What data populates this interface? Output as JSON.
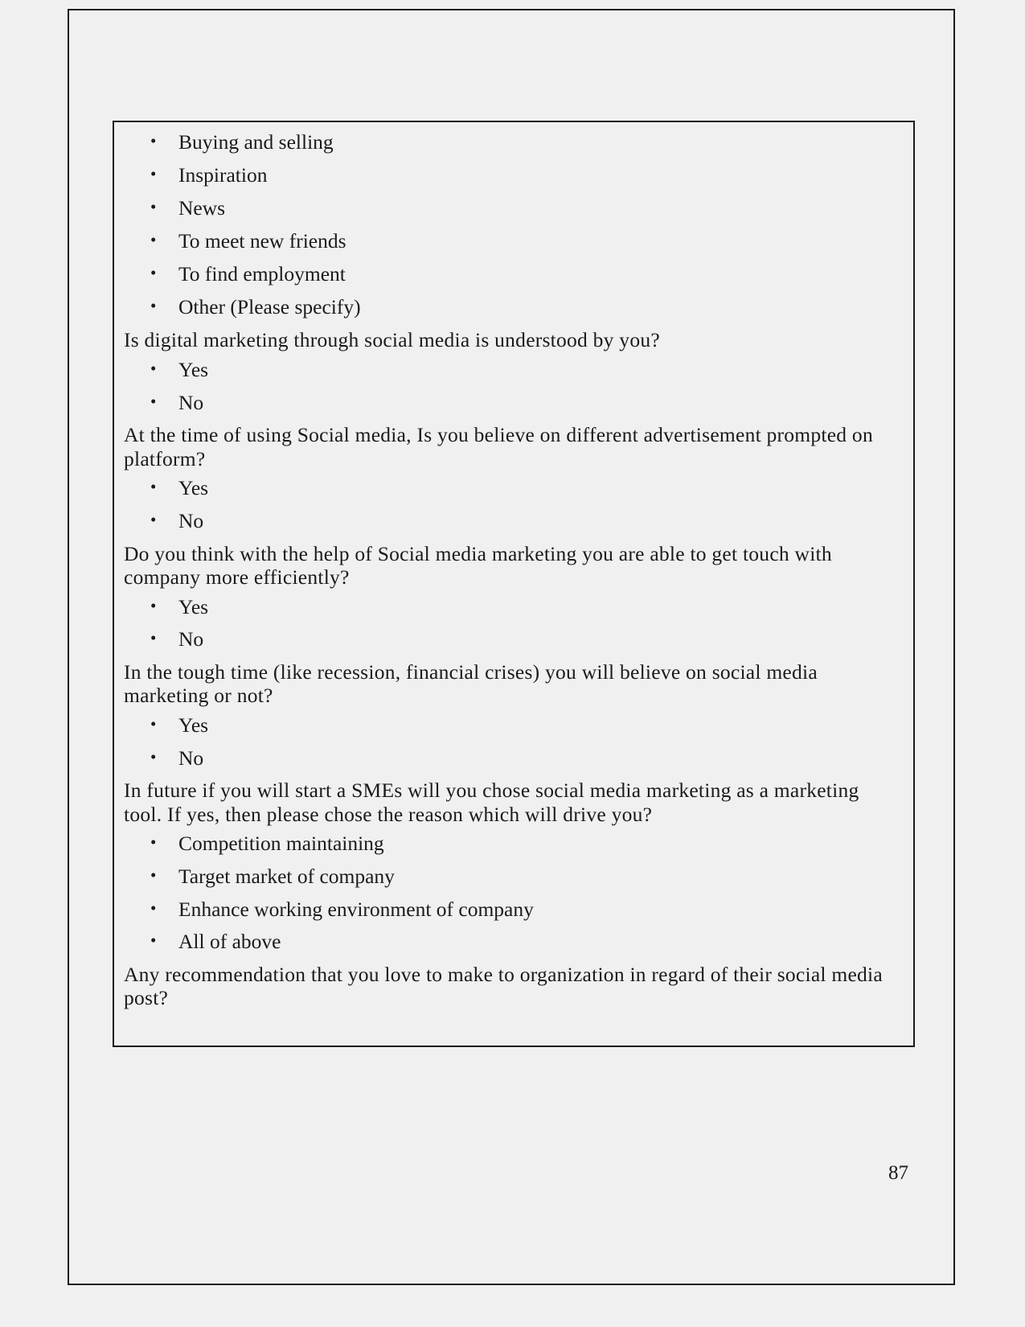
{
  "page": {
    "number": "87",
    "background_color": "#f0f0f0",
    "text_color": "#1a1a1a",
    "border_color": "#1a1a1a"
  },
  "bullet_glyph": "•",
  "blocks": [
    {
      "kind": "list",
      "name": "purpose-of-use-options",
      "items": [
        "Buying and selling",
        "Inspiration",
        "News",
        "To meet new friends",
        "To find employment",
        "Other (Please specify)"
      ]
    },
    {
      "kind": "question",
      "name": "question-digital-marketing-understood",
      "text": "Is digital marketing through social media is understood by you?"
    },
    {
      "kind": "list",
      "name": "answers-digital-marketing-understood",
      "items": [
        "Yes",
        "No"
      ]
    },
    {
      "kind": "question",
      "name": "question-believe-advertisement",
      "text": "At the time of using Social media, Is you believe on different advertisement prompted on platform?"
    },
    {
      "kind": "list",
      "name": "answers-believe-advertisement",
      "items": [
        "Yes",
        "No"
      ]
    },
    {
      "kind": "question",
      "name": "question-get-touch-with-company",
      "text": "Do you think with the help of Social media marketing you are able to get touch with company more efficiently?"
    },
    {
      "kind": "list",
      "name": "answers-get-touch-with-company",
      "items": [
        "Yes",
        "No"
      ]
    },
    {
      "kind": "question",
      "name": "question-tough-time-belief",
      "text": "In the tough time (like recession, financial crises) you will believe on social media marketing or not?"
    },
    {
      "kind": "list",
      "name": "answers-tough-time-belief",
      "items": [
        "Yes",
        "No"
      ]
    },
    {
      "kind": "question",
      "name": "question-future-sme-marketing-tool",
      "text": "In future if you will start a SMEs will you chose social media marketing as a marketing tool. If yes, then please chose the reason which will drive you?"
    },
    {
      "kind": "list",
      "name": "answers-future-sme-reasons",
      "items": [
        "Competition maintaining",
        "Target market of company",
        "Enhance working environment of company",
        "All of above"
      ]
    },
    {
      "kind": "question",
      "name": "question-any-recommendation",
      "text": "Any recommendation that you love to make to organization in regard of their social media post?"
    }
  ]
}
